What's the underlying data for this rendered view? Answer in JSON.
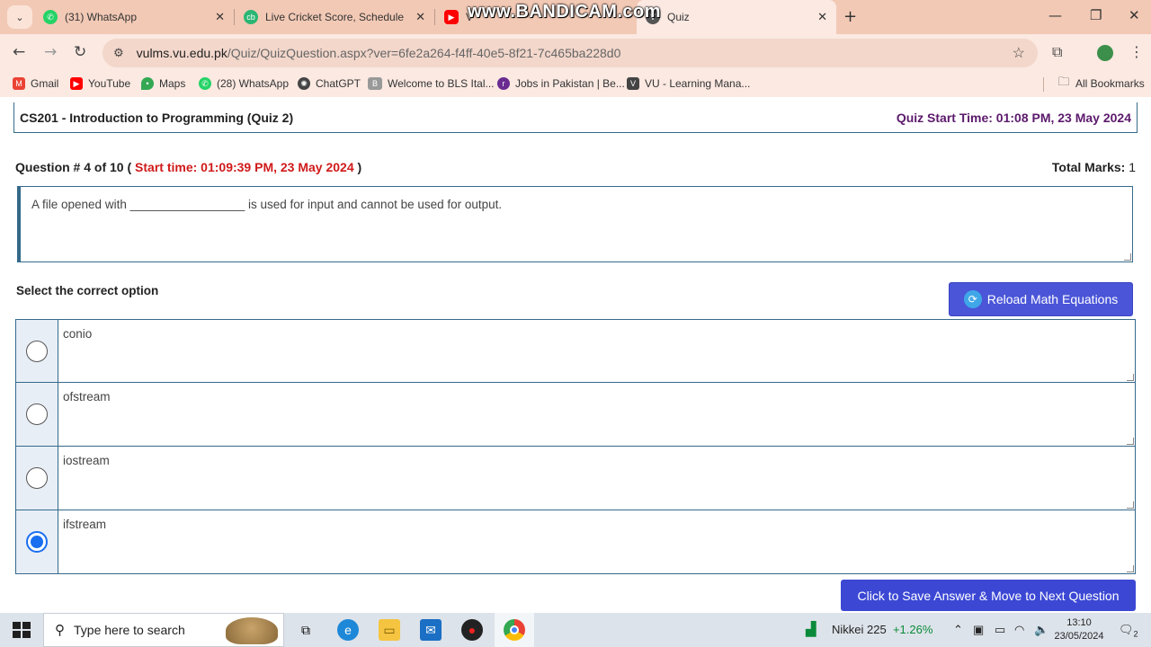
{
  "browser": {
    "tabs": [
      {
        "title": "(31) WhatsApp",
        "icon": "whatsapp-icon",
        "color": "#25d366"
      },
      {
        "title": "Live Cricket Score, Schedule, La",
        "icon": "cricbuzz-icon",
        "color": "#2bb673"
      },
      {
        "title": "V",
        "icon": "youtube-icon",
        "color": "#ff0000"
      },
      {
        "title": "Quiz",
        "icon": "vu-icon",
        "color": "#555555"
      }
    ],
    "watermark": "www.BANDICAM.com",
    "url_host": "vulms.vu.edu.pk",
    "url_path": "/Quiz/QuizQuestion.aspx?ver=6fe2a264-f4ff-40e5-8f21-7c465ba228d0",
    "bookmarks": [
      {
        "label": "Gmail",
        "icon": "gmail-icon",
        "color": "#ea4335"
      },
      {
        "label": "YouTube",
        "icon": "youtube-icon",
        "color": "#ff0000"
      },
      {
        "label": "Maps",
        "icon": "maps-icon",
        "color": "#34a853"
      },
      {
        "label": "(28) WhatsApp",
        "icon": "whatsapp-icon",
        "color": "#25d366"
      },
      {
        "label": "ChatGPT",
        "icon": "chatgpt-icon",
        "color": "#444444"
      },
      {
        "label": "Welcome to BLS Ital...",
        "icon": "bls-icon",
        "color": "#888888"
      },
      {
        "label": "Jobs in Pakistan | Be...",
        "icon": "rozee-icon",
        "color": "#6a2c91"
      },
      {
        "label": "VU - Learning Mana...",
        "icon": "vu-icon",
        "color": "#444444"
      }
    ],
    "all_bookmarks": "All Bookmarks"
  },
  "quiz": {
    "course": "CS201 - Introduction to Programming (Quiz 2)",
    "quiz_start": "Quiz Start Time: 01:08 PM, 23 May 2024",
    "question_label": "Question # 4 of 10",
    "open_paren": " ( ",
    "start_time": "Start time: 01:09:39 PM, 23 May 2024",
    "close_paren": " )",
    "total_marks_label": "Total Marks:",
    "total_marks_value": " 1",
    "question_text": "A file opened with _________________ is used for input and cannot be used for output.",
    "select_label": "Select the correct option",
    "reload_button": "Reload Math Equations",
    "options": [
      {
        "text": "conio",
        "selected": false
      },
      {
        "text": "ofstream",
        "selected": false
      },
      {
        "text": "iostream",
        "selected": false
      },
      {
        "text": "ifstream",
        "selected": true
      }
    ],
    "save_button": "Click to Save Answer & Move to Next Question"
  },
  "taskbar": {
    "search_placeholder": "Type here to search",
    "nikkei_label": "Nikkei 225",
    "nikkei_change": "+1.26%",
    "time": "13:10",
    "date": "23/05/2024",
    "notifications": "2"
  }
}
